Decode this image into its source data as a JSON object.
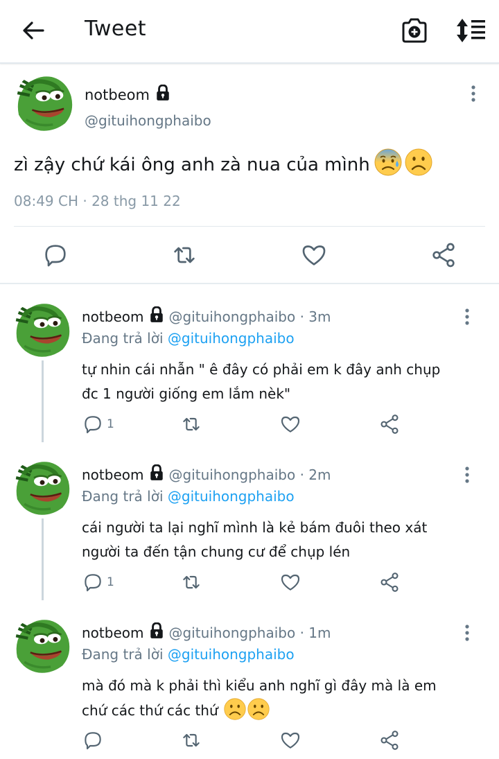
{
  "header": {
    "title": "Tweet"
  },
  "tweet": {
    "name": "notbeom",
    "handle": "@gituihongphaibo",
    "text": "zì zậy chứ kái ông anh zà nua của mình",
    "emojis": [
      "anxious-sweat-face",
      "frowning-face"
    ],
    "timestamp": "08:49 CH · 28 thg 11 22"
  },
  "replies": [
    {
      "name": "notbeom",
      "handle_time": "@gituihongphaibo · 3m",
      "replying_prefix": "Đang trả lời",
      "replying_to": "@gituihongphaibo",
      "line1": "tự nhin cái nhẫn \" ê đây có phải em k đây anh chụp",
      "line2": "đc 1 người giống em lắm nèk\"",
      "reply_count": "1"
    },
    {
      "name": "notbeom",
      "handle_time": "@gituihongphaibo · 2m",
      "replying_prefix": "Đang trả lời",
      "replying_to": "@gituihongphaibo",
      "line1": "cái người ta lại nghĩ mình là kẻ bám đuôi theo xát",
      "line2": "người ta đến tận chung cư để chụp lén",
      "reply_count": "1"
    },
    {
      "name": "notbeom",
      "handle_time": "@gituihongphaibo · 1m",
      "replying_prefix": "Đang trả lời",
      "replying_to": "@gituihongphaibo",
      "line1": "mà đó mà k phải thì kiểu anh nghĩ gì đây mà là em",
      "line2": "chứ các thứ các thứ",
      "emojis": [
        "frowning-face",
        "frowning-face"
      ],
      "reply_count": ""
    }
  ],
  "colors": {
    "link": "#1da1f2",
    "muted": "#657786",
    "icon": "#536471"
  }
}
